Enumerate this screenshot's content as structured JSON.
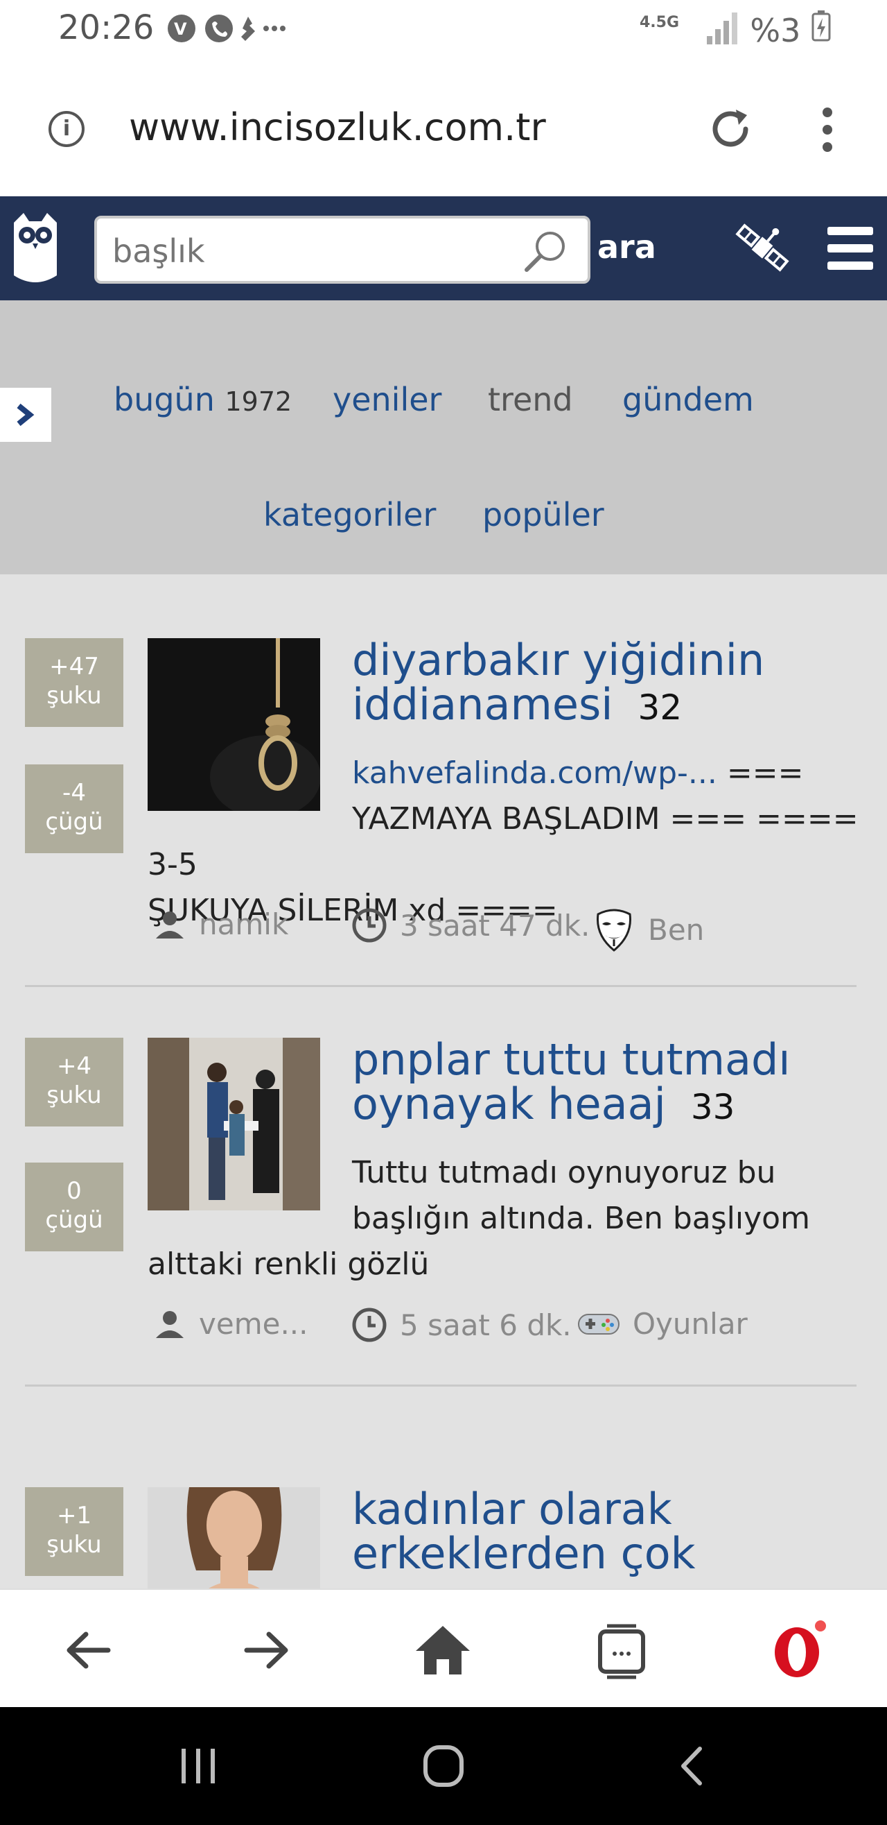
{
  "status": {
    "time": "20:26",
    "network": "4.5G",
    "battery": "%3"
  },
  "browser": {
    "url": "www.incisozluk.com.tr"
  },
  "site": {
    "search_placeholder": "başlık",
    "search_button": "ara"
  },
  "nav": {
    "bugun": "bugün",
    "bugun_count": "1972",
    "yeniler": "yeniler",
    "trend": "trend",
    "gundem": "gündem",
    "kategoriler": "kategoriler",
    "populer": "popüler"
  },
  "entries": [
    {
      "up": "+47",
      "up_label": "şuku",
      "down": "-4",
      "down_label": "çügü",
      "title": "diyarbakır yiğidinin iddianamesi",
      "count": "32",
      "link": "kahvefalinda.com/wp-...",
      "excerpt_a": "===",
      "excerpt_b": "YAZMAYA BAŞLADIM === ==== 3-5",
      "excerpt_c": "ŞUKUYA SİLERİM xd ====",
      "author": "namik",
      "time": "3 saat 47 dk.",
      "category": "Ben",
      "category_icon": "mask-icon"
    },
    {
      "up": "+4",
      "up_label": "şuku",
      "down": "0",
      "down_label": "çügü",
      "title": "pnplar tuttu tutmadı oynayak heaaj",
      "count": "33",
      "excerpt_a": "Tuttu tutmadı oynuyoruz bu",
      "excerpt_b": "başlığın altında. Ben başlıyom",
      "excerpt_c": "alttaki renkli gözlü",
      "author": "veme...",
      "time": "5 saat 6 dk.",
      "category": "Oyunlar",
      "category_icon": "gamepad-icon"
    },
    {
      "up": "+1",
      "up_label": "şuku",
      "title": "kadınlar olarak erkeklerden çok"
    }
  ],
  "colors": {
    "header": "#233355",
    "link": "#1f4e8c",
    "vote": "#afad9c",
    "nav_bg": "#c8c8c8"
  }
}
